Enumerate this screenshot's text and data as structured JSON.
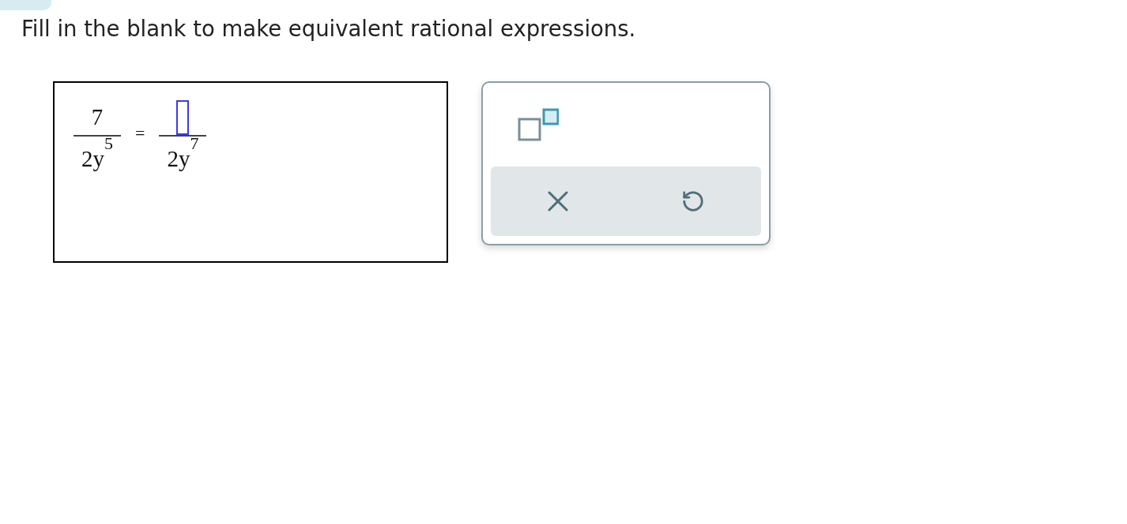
{
  "prompt": "Fill in the blank to make equivalent rational expressions.",
  "equation": {
    "left": {
      "numerator": "7",
      "base": "2y",
      "exponent": "5"
    },
    "relation": "=",
    "right": {
      "numerator_blank": true,
      "base": "2y",
      "exponent": "7"
    }
  },
  "keypad": {
    "template_keys": [
      {
        "kind": "superscript"
      }
    ],
    "action_keys": [
      {
        "kind": "clear"
      },
      {
        "kind": "undo"
      }
    ]
  }
}
